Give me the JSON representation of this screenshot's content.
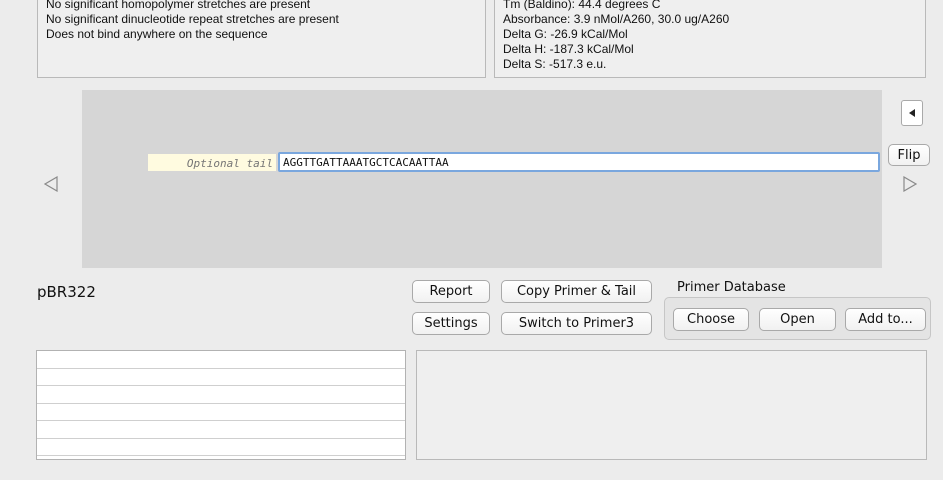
{
  "info_left": {
    "lines": [
      "No significant homopolymer stretches are present",
      "No significant dinucleotide repeat stretches are present",
      "Does not bind anywhere on the sequence"
    ]
  },
  "info_right": {
    "lines": [
      "Tm (Baldino): 44.4 degrees C",
      "Absorbance: 3.9 nMol/A260, 30.0 ug/A260",
      "Delta G: -26.9 kCal/Mol",
      "Delta H: -187.3 kCal/Mol",
      "Delta S: -517.3 e.u."
    ]
  },
  "primer": {
    "tail_placeholder": "Optional tail",
    "sequence": "AGGTTGATTAAATGCTCACAATTAA"
  },
  "controls": {
    "flip_label": "Flip"
  },
  "sequence_name": "pBR322",
  "buttons": {
    "report": "Report",
    "copy_primer_tail": "Copy Primer & Tail",
    "settings": "Settings",
    "switch_primer3": "Switch to Primer3"
  },
  "primer_database": {
    "label": "Primer Database",
    "choose": "Choose",
    "open": "Open",
    "add_to": "Add to..."
  },
  "icons": {
    "left_arrow": "triangle-left-icon",
    "right_arrow": "triangle-right-icon",
    "collapse": "triangle-left-filled-icon"
  }
}
